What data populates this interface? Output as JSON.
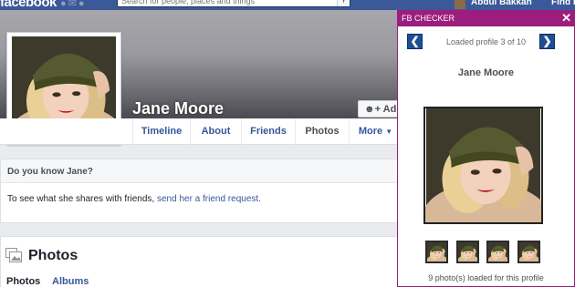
{
  "topbar": {
    "logo": "facebook",
    "search_placeholder": "Search for people, places and things",
    "user_name": "Abdul Bakkah",
    "find_friends": "Find Fri"
  },
  "profile": {
    "name": "Jane Moore",
    "add_friend_label": "Add F"
  },
  "nav": {
    "tabs": [
      "Timeline",
      "About",
      "Friends",
      "Photos",
      "More"
    ],
    "active": "Photos"
  },
  "know": {
    "question": "Do you know Jane?",
    "body_prefix": "To see what she shares with friends,",
    "link_text": "send her a friend request."
  },
  "photos": {
    "title": "Photos",
    "tabs": [
      "Photos",
      "Albums"
    ]
  },
  "checker": {
    "title": "FB CHECKER",
    "status": "Loaded profile 3 of 10",
    "profile_name": "Jane Moore",
    "photos_loaded": "9 photo(s) loaded for this profile",
    "thumb_count": 4
  },
  "colors": {
    "fb_blue": "#3b5998",
    "checker_accent": "#9b1e7e",
    "link_blue": "#365899",
    "arrow_blue": "#1f4e95"
  }
}
